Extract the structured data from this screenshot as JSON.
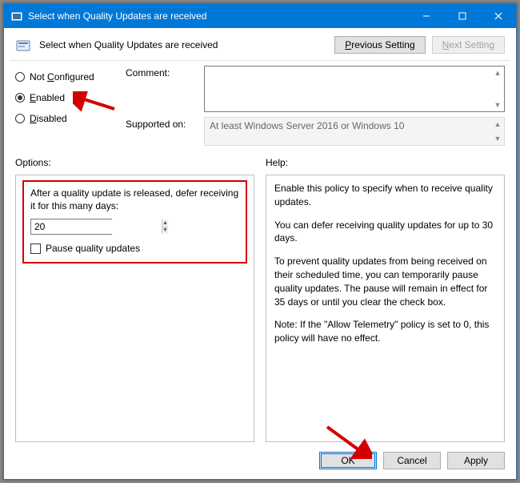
{
  "titlebar": {
    "title": "Select when Quality Updates are received"
  },
  "header": {
    "title": "Select when Quality Updates are received",
    "prev_label": "Previous Setting",
    "next_label": "Next Setting"
  },
  "state": {
    "not_configured_label_pre": "Not ",
    "not_configured_key": "C",
    "not_configured_label_post": "onfigured",
    "enabled_key": "E",
    "enabled_label_post": "nabled",
    "disabled_key": "D",
    "disabled_label_post": "isabled",
    "selected": "enabled"
  },
  "fields": {
    "comment_label": "Comment:",
    "comment_value": "",
    "supported_label": "Supported on:",
    "supported_value": "At least Windows Server 2016 or Windows 10"
  },
  "section_labels": {
    "options": "Options:",
    "help": "Help:"
  },
  "options": {
    "description": "After a quality update is released, defer receiving it for this many days:",
    "spin_value": "20",
    "pause_label": "Pause quality updates",
    "pause_checked": false
  },
  "help": {
    "p1": "Enable this policy to specify when to receive quality updates.",
    "p2": "You can defer receiving quality updates for up to 30 days.",
    "p3": "To prevent quality updates from being received on their scheduled time, you can temporarily pause quality updates. The pause will remain in effect for 35 days or until you clear the check box.",
    "p4": "Note: If the \"Allow Telemetry\" policy is set to 0, this policy will have no effect."
  },
  "footer": {
    "ok": "OK",
    "cancel": "Cancel",
    "apply": "Apply"
  },
  "nav_prev_key": "P",
  "nav_prev_post": "revious Setting",
  "nav_next_pre": "",
  "nav_next_key": "N",
  "nav_next_post": "ext Setting"
}
